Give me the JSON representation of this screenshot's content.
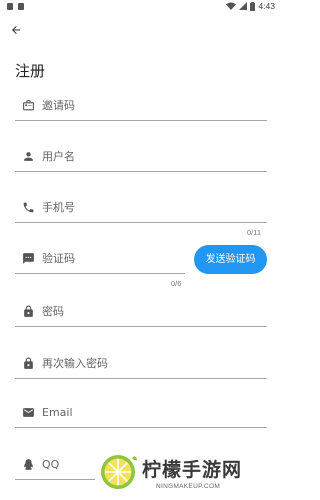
{
  "status_bar": {
    "time": "4:43"
  },
  "page": {
    "title": "注册"
  },
  "form": {
    "invite_code": {
      "placeholder": "邀请码",
      "icon": "card-icon"
    },
    "username": {
      "placeholder": "用户名",
      "icon": "person-icon"
    },
    "phone": {
      "placeholder": "手机号",
      "icon": "phone-icon",
      "counter": "0/11"
    },
    "verification_code": {
      "placeholder": "验证码",
      "icon": "sms-icon",
      "counter": "0/6"
    },
    "send_code_label": "发送验证码",
    "password": {
      "placeholder": "密码",
      "icon": "lock-icon"
    },
    "confirm_password": {
      "placeholder": "再次输入密码",
      "icon": "lock-icon"
    },
    "email": {
      "placeholder": "Email",
      "icon": "mail-icon"
    },
    "qq": {
      "placeholder": "QQ",
      "icon": "qq-icon"
    }
  },
  "watermark": {
    "name": "柠檬手游网",
    "url": "NINGMAKEUP.COM"
  },
  "colors": {
    "accent": "#2196f3",
    "underline": "#a6a6a6",
    "icon": "#555555"
  }
}
